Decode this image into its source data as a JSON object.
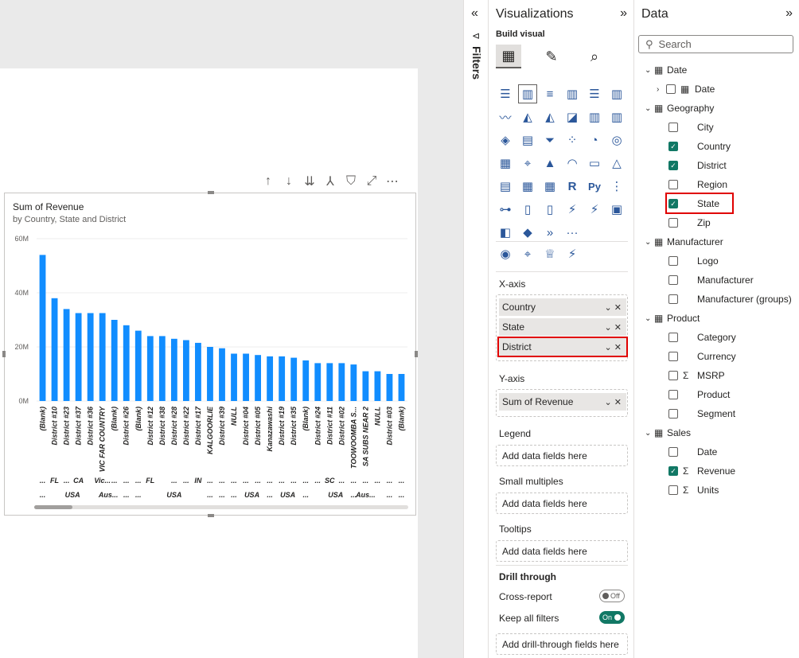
{
  "canvas": {
    "toolbar_icons": [
      "arrow-up-icon",
      "arrow-down-icon",
      "double-arrow-down-icon",
      "expand-hierarchy-icon",
      "filter-icon",
      "focus-mode-icon",
      "more-options-icon"
    ]
  },
  "visual": {
    "title": "Sum of Revenue",
    "subtitle": "by Country, State and District"
  },
  "chart_data": {
    "type": "bar",
    "title": "Sum of Revenue",
    "subtitle": "by Country, State and District",
    "y_ticks": [
      "60M",
      "40M",
      "20M",
      "0M"
    ],
    "ylim": [
      0,
      60000000
    ],
    "grid": true,
    "bar_color": "#118dff",
    "categories": [
      "(Blank)",
      "District #10",
      "District #23",
      "District #37",
      "District #36",
      "VIC FAR COUNTRY",
      "(Blank)",
      "District #26",
      "(Blank)",
      "District #12",
      "District #38",
      "District #28",
      "District #22",
      "District #17",
      "KALGOORLIE",
      "District #39",
      "NULL",
      "District #04",
      "District #05",
      "Kanazawashi",
      "District #19",
      "District #35",
      "(Blank)",
      "District #24",
      "District #11",
      "District #02",
      "TOOWOOMBA S...",
      "SA SUBS NEAR 2",
      "NULL",
      "District #03",
      "(Blank)"
    ],
    "values": [
      54000000,
      38000000,
      34000000,
      32500000,
      32500000,
      32500000,
      30000000,
      28000000,
      26000000,
      24000000,
      24000000,
      23000000,
      22500000,
      21500000,
      20000000,
      19500000,
      17500000,
      17500000,
      17000000,
      16500000,
      16500000,
      16000000,
      15000000,
      14000000,
      14000000,
      14000000,
      13500000,
      11000000,
      11000000,
      10000000,
      10000000
    ],
    "state_labels": [
      {
        "text": "...",
        "bar": 0
      },
      {
        "text": "FL",
        "bar": 1
      },
      {
        "text": "...",
        "bar": 2
      },
      {
        "text": "CA",
        "bar": 3
      },
      {
        "text": "Vic...",
        "bar": 5
      },
      {
        "text": "...",
        "bar": 6
      },
      {
        "text": "...",
        "bar": 7
      },
      {
        "text": "...",
        "bar": 8
      },
      {
        "text": "FL",
        "bar": 9
      },
      {
        "text": "...",
        "bar": 11
      },
      {
        "text": "...",
        "bar": 12
      },
      {
        "text": "IN",
        "bar": 13
      },
      {
        "text": "...",
        "bar": 14
      },
      {
        "text": "...",
        "bar": 15
      },
      {
        "text": "...",
        "bar": 16
      },
      {
        "text": "...",
        "bar": 17
      },
      {
        "text": "...",
        "bar": 18
      },
      {
        "text": "...",
        "bar": 19
      },
      {
        "text": "...",
        "bar": 20
      },
      {
        "text": "...",
        "bar": 21
      },
      {
        "text": "...",
        "bar": 22
      },
      {
        "text": "...",
        "bar": 23
      },
      {
        "text": "SC",
        "bar": 24
      },
      {
        "text": "...",
        "bar": 25
      },
      {
        "text": "...",
        "bar": 26
      },
      {
        "text": "...",
        "bar": 27
      },
      {
        "text": "...",
        "bar": 28
      },
      {
        "text": "...",
        "bar": 29
      },
      {
        "text": "...",
        "bar": 30
      }
    ],
    "country_labels": [
      {
        "text": "...",
        "bar": 0
      },
      {
        "text": "USA",
        "bar": 2.5
      },
      {
        "text": "Aus...",
        "bar": 5.5
      },
      {
        "text": "...",
        "bar": 7
      },
      {
        "text": "...",
        "bar": 8
      },
      {
        "text": "USA",
        "bar": 11
      },
      {
        "text": "...",
        "bar": 14
      },
      {
        "text": "...",
        "bar": 15
      },
      {
        "text": "...",
        "bar": 16
      },
      {
        "text": "USA",
        "bar": 17.5
      },
      {
        "text": "...",
        "bar": 19
      },
      {
        "text": "USA",
        "bar": 20.5
      },
      {
        "text": "...",
        "bar": 22
      },
      {
        "text": "USA",
        "bar": 24.5
      },
      {
        "text": "...",
        "bar": 26
      },
      {
        "text": "Aus...",
        "bar": 27
      },
      {
        "text": "...",
        "bar": 29
      },
      {
        "text": "...",
        "bar": 30
      }
    ]
  },
  "filters": {
    "label": "Filters"
  },
  "viz": {
    "title": "Visualizations",
    "build_label": "Build visual",
    "tabs": [
      "build-visual-icon",
      "format-visual-icon",
      "analytics-icon"
    ],
    "more_glyph": "···",
    "xaxis_label": "X-axis",
    "xaxis_fields": [
      "Country",
      "State",
      "District"
    ],
    "yaxis_label": "Y-axis",
    "yaxis_fields": [
      "Sum of Revenue"
    ],
    "legend_label": "Legend",
    "small_multiples_label": "Small multiples",
    "tooltips_label": "Tooltips",
    "add_fields": "Add data fields here",
    "drill_through_label": "Drill through",
    "cross_report_label": "Cross-report",
    "cross_report_state": "Off",
    "keep_filters_label": "Keep all filters",
    "keep_filters_state": "On",
    "add_drill": "Add drill-through fields here"
  },
  "data": {
    "title": "Data",
    "search_placeholder": "Search",
    "tree": [
      {
        "label": "Date",
        "level": 0,
        "expanded": true
      },
      {
        "label": "Date",
        "level": 1,
        "checked": false,
        "collapsed": true
      },
      {
        "label": "Geography",
        "level": 0,
        "expanded": true
      },
      {
        "label": "City",
        "level": 1,
        "checked": false
      },
      {
        "label": "Country",
        "level": 1,
        "checked": true
      },
      {
        "label": "District",
        "level": 1,
        "checked": true
      },
      {
        "label": "Region",
        "level": 1,
        "checked": false
      },
      {
        "label": "State",
        "level": 1,
        "checked": true
      },
      {
        "label": "Zip",
        "level": 1,
        "checked": false
      },
      {
        "label": "Manufacturer",
        "level": 0,
        "expanded": true
      },
      {
        "label": "Logo",
        "level": 1,
        "checked": false
      },
      {
        "label": "Manufacturer",
        "level": 1,
        "checked": false
      },
      {
        "label": "Manufacturer (groups)",
        "level": 1,
        "checked": false
      },
      {
        "label": "Product",
        "level": 0,
        "expanded": true
      },
      {
        "label": "Category",
        "level": 1,
        "checked": false
      },
      {
        "label": "Currency",
        "level": 1,
        "checked": false
      },
      {
        "label": "MSRP",
        "level": 1,
        "checked": false,
        "sigma": true
      },
      {
        "label": "Product",
        "level": 1,
        "checked": false
      },
      {
        "label": "Segment",
        "level": 1,
        "checked": false
      },
      {
        "label": "Sales",
        "level": 0,
        "expanded": true
      },
      {
        "label": "Date",
        "level": 1,
        "checked": false
      },
      {
        "label": "Revenue",
        "level": 1,
        "checked": true,
        "sigma": true
      },
      {
        "label": "Units",
        "level": 1,
        "checked": false,
        "sigma": true
      }
    ]
  },
  "colors": {
    "accent": "#117865",
    "bar": "#118dff",
    "highlight": "#e00000"
  }
}
